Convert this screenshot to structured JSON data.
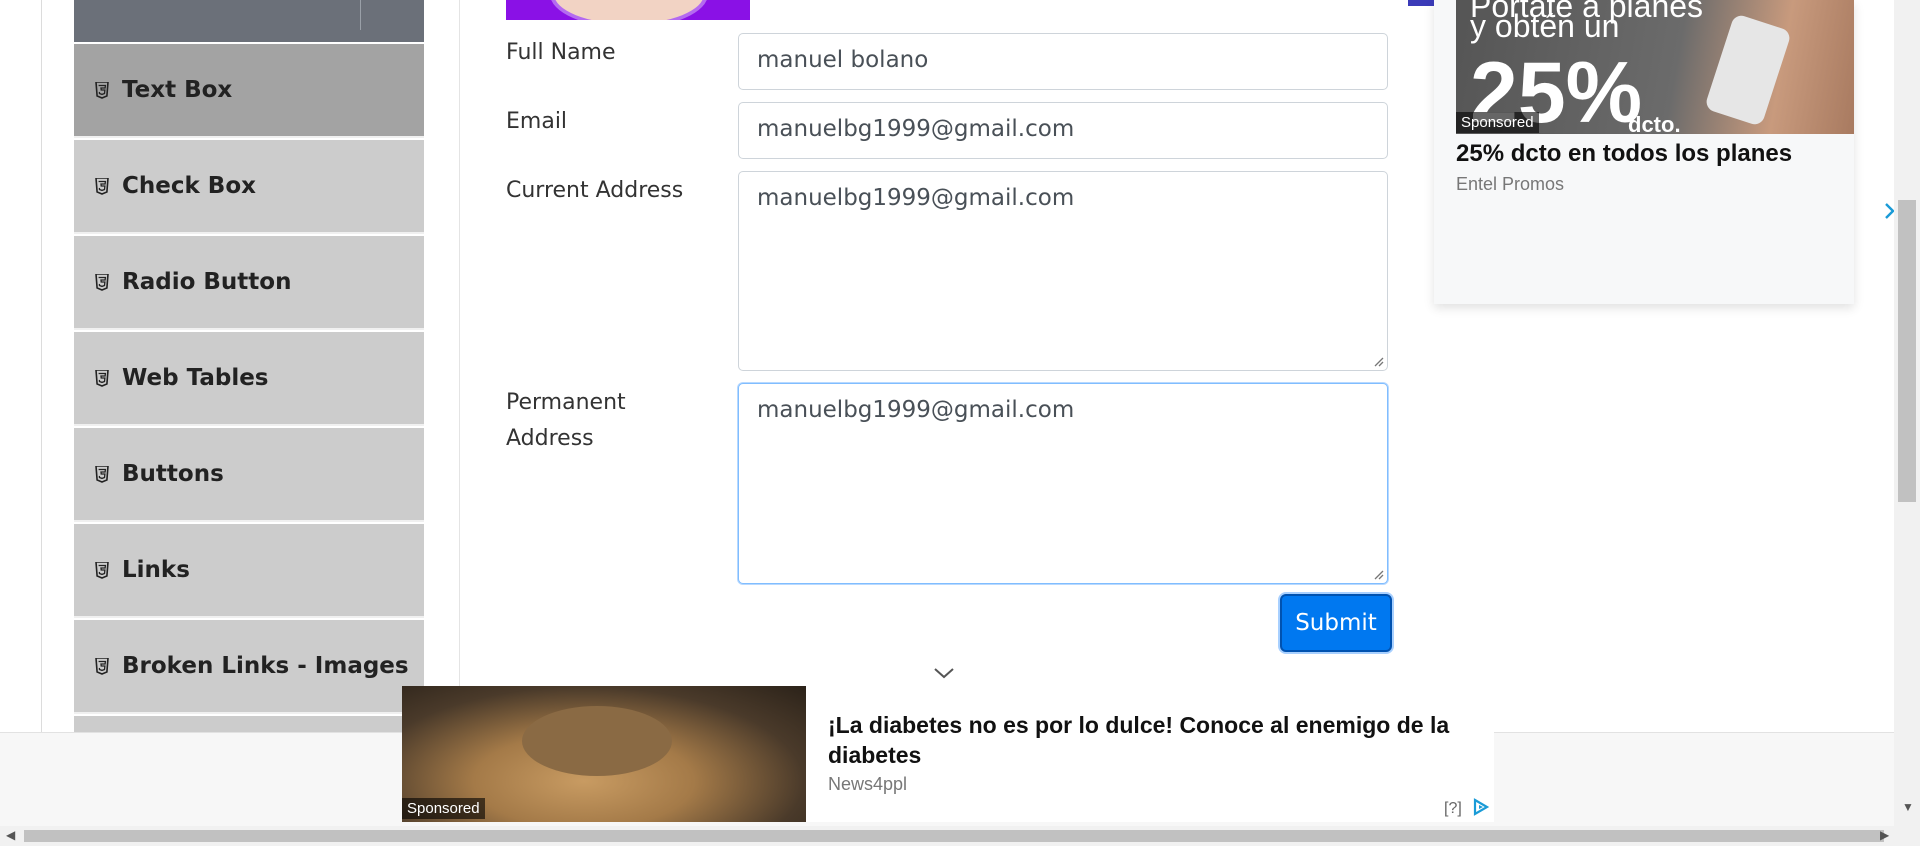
{
  "sidebar": {
    "items": [
      {
        "label": "Text Box",
        "active": true
      },
      {
        "label": "Check Box",
        "active": false
      },
      {
        "label": "Radio Button",
        "active": false
      },
      {
        "label": "Web Tables",
        "active": false
      },
      {
        "label": "Buttons",
        "active": false
      },
      {
        "label": "Links",
        "active": false
      },
      {
        "label": "Broken Links - Images",
        "active": false
      }
    ]
  },
  "form": {
    "full_name": {
      "label": "Full Name",
      "value": "manuel bolano"
    },
    "email": {
      "label": "Email",
      "value": "manuelbg1999@gmail.com"
    },
    "current_address": {
      "label": "Current Address",
      "value": "manuelbg1999@gmail.com"
    },
    "permanent_address": {
      "label_line1": "Permanent",
      "label_line2": "Address",
      "value": "manuelbg1999@gmail.com"
    },
    "submit_label": "Submit"
  },
  "right_ad": {
    "promo_line1": "Portate a planes",
    "promo_line2": "y obtén un",
    "promo_big": "25%",
    "promo_small": "dcto.",
    "sponsored": "Sponsored",
    "headline": "25% dcto en todos los planes",
    "advertiser": "Entel Promos",
    "help": "[?]"
  },
  "bottom_ad": {
    "sponsored": "Sponsored",
    "headline": "¡La diabetes no es por lo dulce! Conoce al enemigo de la diabetes",
    "advertiser": "News4ppl",
    "help": "[?]"
  },
  "colors": {
    "sidebar_active": "#a3a3a3",
    "sidebar_item": "#cccccc",
    "submit_button": "#0078f0",
    "focused_border": "#80bdff"
  }
}
